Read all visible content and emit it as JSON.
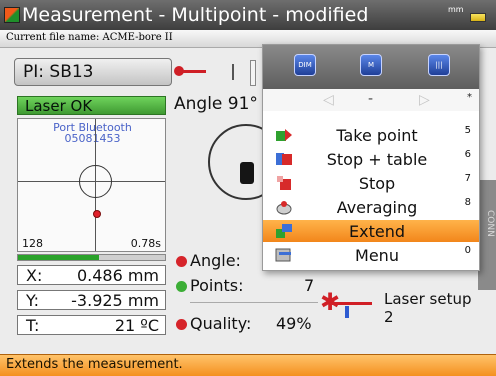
{
  "titlebar": {
    "title": "Measurement - Multipoint - modified",
    "units": "mm"
  },
  "filebar": {
    "label": "Current file name: ACME-bore II"
  },
  "pi": {
    "label": "PI: SB13"
  },
  "laser_status": {
    "label": "Laser OK",
    "color": "#4caf3c"
  },
  "angle_top": "Angle 91°",
  "target": {
    "port": "Port Bluetooth",
    "port_id": "05081453",
    "readout_left": "128",
    "readout_right": "0.78s",
    "progress": 0.55
  },
  "values": [
    {
      "label": "X:",
      "value": "0.486 mm"
    },
    {
      "label": "Y:",
      "value": "-3.925 mm"
    },
    {
      "label": "T:",
      "value": "21 ºC"
    }
  ],
  "stats": {
    "angle_label": "Angle:",
    "points_label": "Points:",
    "points_value": "7",
    "quality_label": "Quality:",
    "quality_value": "49%"
  },
  "laser_setup": {
    "label": "Laser setup",
    "value": "2"
  },
  "rail": {
    "text": "CONN"
  },
  "menu": {
    "tabs": [
      {
        "icon": "dimensions-icon",
        "text": "DIM"
      },
      {
        "icon": "measure-icon",
        "text": "M"
      },
      {
        "icon": "table-icon",
        "text": "|||"
      }
    ],
    "nav": {
      "left": "◁",
      "center": "-",
      "right": "▷",
      "star": "*"
    },
    "items": [
      {
        "label": "Take point",
        "num": "5",
        "icon": "take-point-icon"
      },
      {
        "label": "Stop + table",
        "num": "6",
        "icon": "stop-table-icon"
      },
      {
        "label": "Stop",
        "num": "7",
        "icon": "stop-icon"
      },
      {
        "label": "Averaging",
        "num": "8",
        "icon": "averaging-icon"
      },
      {
        "label": "Extend",
        "num": "",
        "icon": "extend-icon",
        "selected": true
      },
      {
        "label": "Menu",
        "num": "0",
        "icon": "menu-icon"
      }
    ]
  },
  "status": {
    "text": "Extends the measurement."
  },
  "colors": {
    "accent_orange": "#f2861b",
    "laser_red": "#d01f26",
    "ok_green": "#3f9a32",
    "tab_blue": "#1f3f98"
  }
}
